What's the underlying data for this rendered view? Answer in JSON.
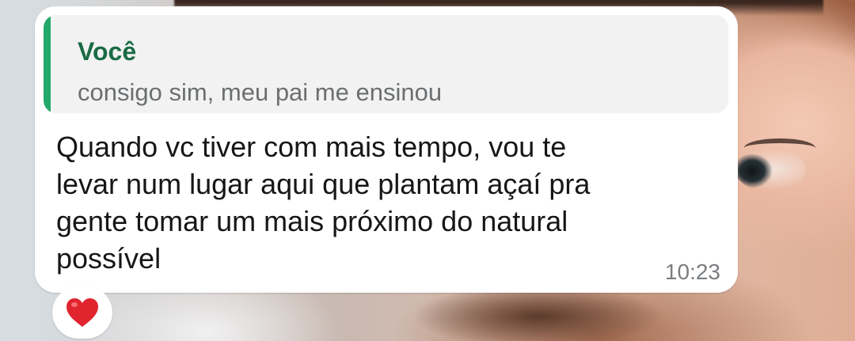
{
  "message": {
    "quoted_author": "Você",
    "quoted_text": "consigo sim, meu pai me ensinou",
    "text": "Quando vc tiver com mais tempo, vou te\nlevar num lugar aqui que plantam açaí pra\ngente tomar um mais próximo do natural\npossível",
    "time": "10:23",
    "reaction": "heart-icon"
  },
  "colors": {
    "quote_bar": "#25a96a",
    "quote_author": "#1a6b45",
    "bubble": "#ffffff",
    "reaction_heart": "#e0252f"
  }
}
